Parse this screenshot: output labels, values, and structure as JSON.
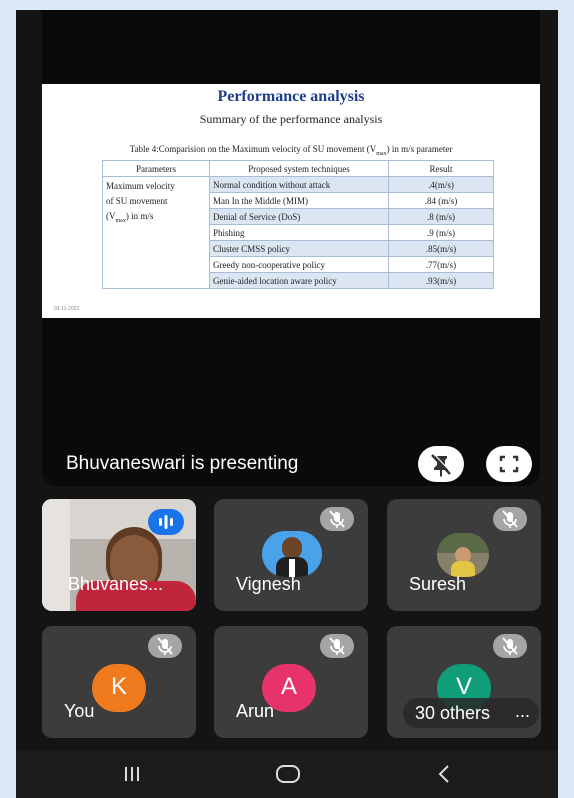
{
  "slide": {
    "title": "Performance analysis",
    "subtitle": "Summary of the performance analysis",
    "caption_pre": "Table 4:Comparision on the Maximum velocity of SU movement (V",
    "caption_sub": "max",
    "caption_post": ") in m/s parameter",
    "table": {
      "headers": [
        "Parameters",
        "Proposed system techniques",
        "Result"
      ],
      "parameter_lines": [
        "Maximum velocity",
        "of SU movement",
        "(V",
        "max",
        ") in m/s"
      ],
      "rows": [
        {
          "technique": "Normal condition without attack",
          "result": ".4(m/s)"
        },
        {
          "technique": "Man In the Middle (MIM)",
          "result": ".84 (m/s)"
        },
        {
          "technique": "Denial of Service (DoS)",
          "result": ".8 (m/s)"
        },
        {
          "technique": "Phishing",
          "result": ".9 (m/s)"
        },
        {
          "technique": "Cluster CMSS policy",
          "result": ".85(m/s)"
        },
        {
          "technique": "Greedy non-cooperative policy",
          "result": ".77(m/s)"
        },
        {
          "technique": "Genie-aided location aware policy",
          "result": ".93(m/s)"
        }
      ]
    },
    "date": "03-11-2022"
  },
  "presenting": {
    "label": "Bhuvaneswari is presenting",
    "unpin_icon": "pin-off-icon",
    "fullscreen_icon": "fullscreen-icon"
  },
  "participants": [
    {
      "name": "Bhuvanes...",
      "type": "video",
      "status": "speaking"
    },
    {
      "name": "Vignesh",
      "type": "photo",
      "status": "muted"
    },
    {
      "name": "Suresh",
      "type": "photo",
      "status": "muted"
    },
    {
      "name": "You",
      "initial": "K",
      "color": "#f07b1f",
      "status": "muted"
    },
    {
      "name": "Arun",
      "initial": "A",
      "color": "#e8336a",
      "status": "muted"
    },
    {
      "name": "30 others",
      "initial": "V",
      "color": "#0f9d7a",
      "status": "muted"
    }
  ],
  "nav": {
    "recents_icon": "recents-icon",
    "home_icon": "home-icon",
    "back_icon": "back-icon"
  }
}
